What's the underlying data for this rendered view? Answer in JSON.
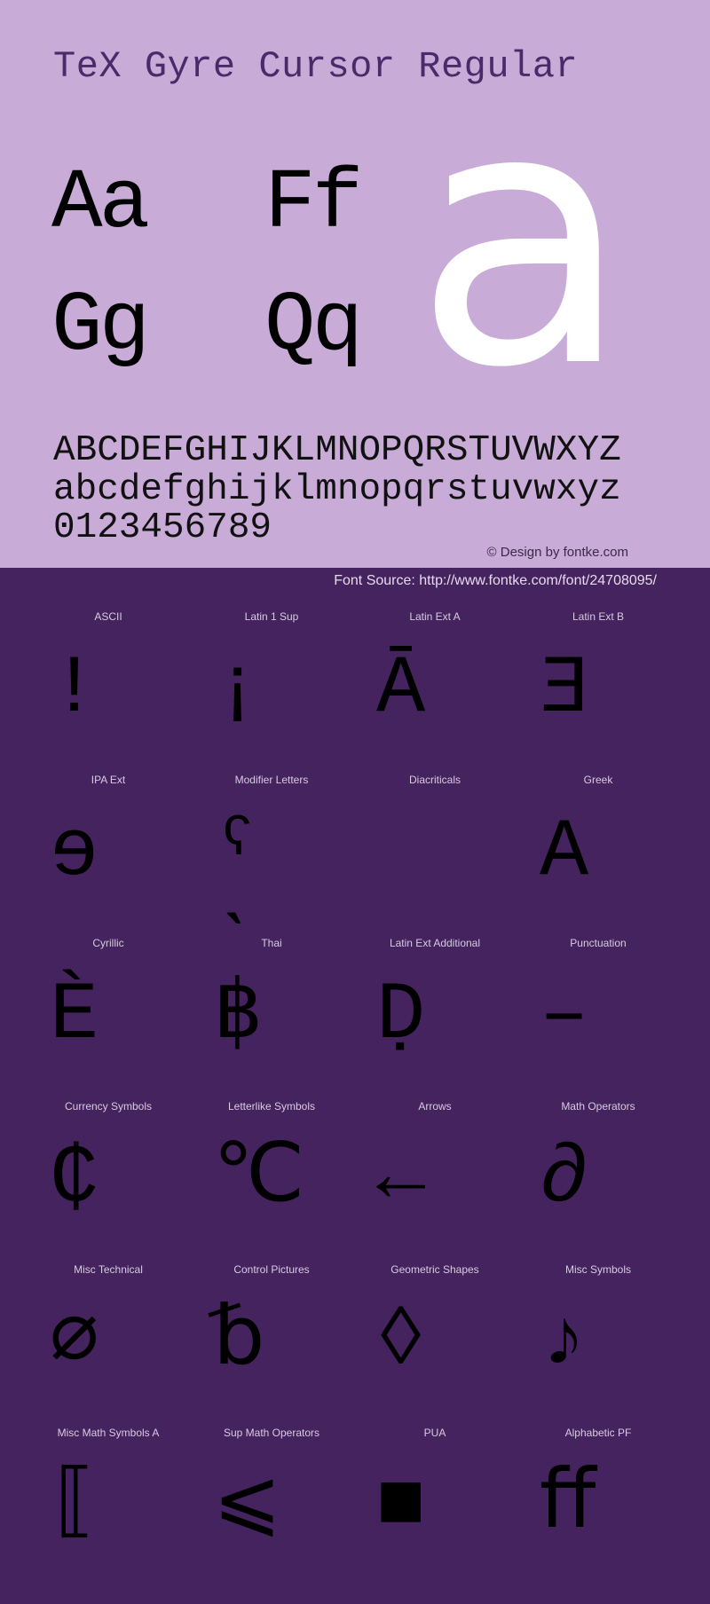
{
  "header": {
    "title": "TeX Gyre Cursor Regular"
  },
  "specimens": {
    "pair1": "Aa",
    "pair2": "Ff",
    "pair3": "Gg",
    "pair4": "Qq",
    "big_glyph": "a"
  },
  "alphabet": {
    "uppercase": "ABCDEFGHIJKLMNOPQRSTUVWXYZ",
    "lowercase": "abcdefghijklmnopqrstuvwxyz",
    "digits": "0123456789"
  },
  "credit": "© Design by fontke.com",
  "font_source": "Font Source: http://www.fontke.com/font/24708095/",
  "colors": {
    "top_background": "#c8abd7",
    "bottom_background": "#44235e",
    "title_color": "#4b2a6a",
    "big_glyph_color": "#ffffff"
  },
  "blocks": [
    {
      "label": "ASCII",
      "glyph": "!"
    },
    {
      "label": "Latin 1 Sup",
      "glyph": "¡"
    },
    {
      "label": "Latin Ext A",
      "glyph": "Ā"
    },
    {
      "label": "Latin Ext B",
      "glyph": "Ǝ"
    },
    {
      "label": "IPA Ext",
      "glyph": "ɘ"
    },
    {
      "label": "Modifier Letters",
      "glyph": "ˁ ˋ"
    },
    {
      "label": "Diacriticals",
      "glyph": ""
    },
    {
      "label": "Greek",
      "glyph": "Α"
    },
    {
      "label": "Cyrillic",
      "glyph": "Ѐ"
    },
    {
      "label": "Thai",
      "glyph": "฿"
    },
    {
      "label": "Latin Ext Additional",
      "glyph": "Ḍ"
    },
    {
      "label": "Punctuation",
      "glyph": "–"
    },
    {
      "label": "Currency Symbols",
      "glyph": "₵"
    },
    {
      "label": "Letterlike Symbols",
      "glyph": "℃"
    },
    {
      "label": "Arrows",
      "glyph": "←"
    },
    {
      "label": "Math Operators",
      "glyph": "∂"
    },
    {
      "label": "Misc Technical",
      "glyph": "⌀"
    },
    {
      "label": "Control Pictures",
      "glyph": "␢"
    },
    {
      "label": "Geometric Shapes",
      "glyph": "◊"
    },
    {
      "label": "Misc Symbols",
      "glyph": "♪"
    },
    {
      "label": "Misc Math Symbols A",
      "glyph": "⟦"
    },
    {
      "label": "Sup Math Operators",
      "glyph": "⩽"
    },
    {
      "label": "PUA",
      "glyph": "■"
    },
    {
      "label": "Alphabetic PF",
      "glyph": "ﬀ"
    }
  ]
}
